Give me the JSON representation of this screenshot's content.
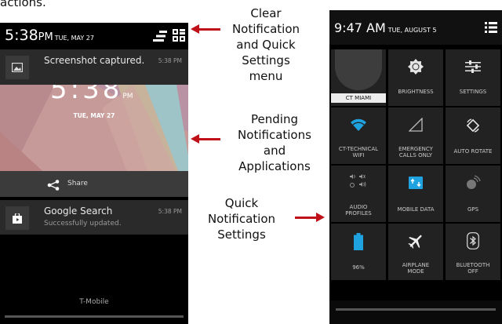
{
  "top_fragment": "actions.",
  "annotations": {
    "clear": "Clear\nNotification\nand Quick\nSettings\nmenu",
    "pending": "Pending\nNotifications\nand\nApplications",
    "quick": "Quick\nNotification\nSettings"
  },
  "left_phone": {
    "status_time": "5:38",
    "status_ampm": "PM",
    "status_date": "TUE, MAY 27",
    "lock_time_partial": "5:38",
    "lock_ampm": "PM",
    "lock_date": "TUE, MAY 27",
    "notifications": [
      {
        "title": "Screenshot captured.",
        "time": "5:38 PM"
      },
      {
        "title": "Google Search",
        "subtitle": "Successfully updated.",
        "time": "5:38 PM"
      }
    ],
    "share_label": "Share",
    "carrier": "T-Mobile"
  },
  "right_phone": {
    "status_time": "9:47 AM",
    "status_date": "TUE, AUGUST 5",
    "tiles": [
      {
        "label": "CT MIAMI",
        "icon": "avatar-icon"
      },
      {
        "label": "BRIGHTNESS",
        "icon": "brightness-icon"
      },
      {
        "label": "SETTINGS",
        "icon": "settings-sliders-icon"
      },
      {
        "label": "CT-TECHNICAL\nWIFI",
        "icon": "wifi-icon"
      },
      {
        "label": "EMERGENCY\nCALLS ONLY",
        "icon": "signal-icon"
      },
      {
        "label": "AUTO ROTATE",
        "icon": "auto-rotate-icon"
      },
      {
        "label": "AUDIO\nPROFILES",
        "icon": "audio-profiles-icon"
      },
      {
        "label": "MOBILE DATA",
        "icon": "mobile-data-icon"
      },
      {
        "label": "GPS",
        "icon": "gps-icon"
      },
      {
        "label": "96%",
        "icon": "battery-icon"
      },
      {
        "label": "AIRPLANE\nMODE",
        "icon": "airplane-icon"
      },
      {
        "label": "BLUETOOTH\nOFF",
        "icon": "bluetooth-icon"
      }
    ]
  },
  "colors": {
    "arrow": "#c0101a",
    "accent_blue": "#1fa3e0",
    "tile_bg": "#222222"
  }
}
